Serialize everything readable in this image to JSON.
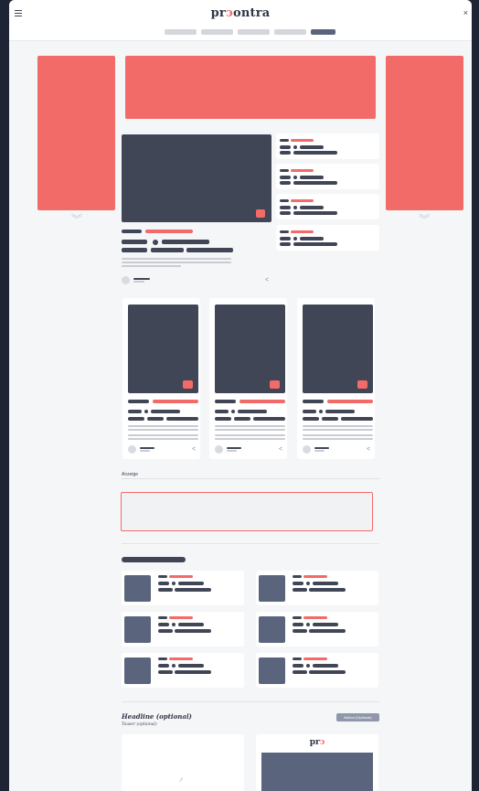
{
  "header": {
    "logo_prefix": "pr",
    "logo_accent": "ↄ",
    "logo_suffix": "ontra",
    "close": "×"
  },
  "tabs": [
    {
      "active": false
    },
    {
      "active": false
    },
    {
      "active": false
    },
    {
      "active": false
    },
    {
      "active": true
    }
  ],
  "section_label": "Anzeige",
  "headline_block": {
    "title": "Headline (optional)",
    "teaser": "Teaser (optional)",
    "button": "Button (Optional)"
  },
  "bottom_logo": {
    "prefix": "pr",
    "accent": "ↄ"
  },
  "colors": {
    "accent": "#f26b68",
    "dark": "#404656",
    "slate": "#5a647c"
  }
}
